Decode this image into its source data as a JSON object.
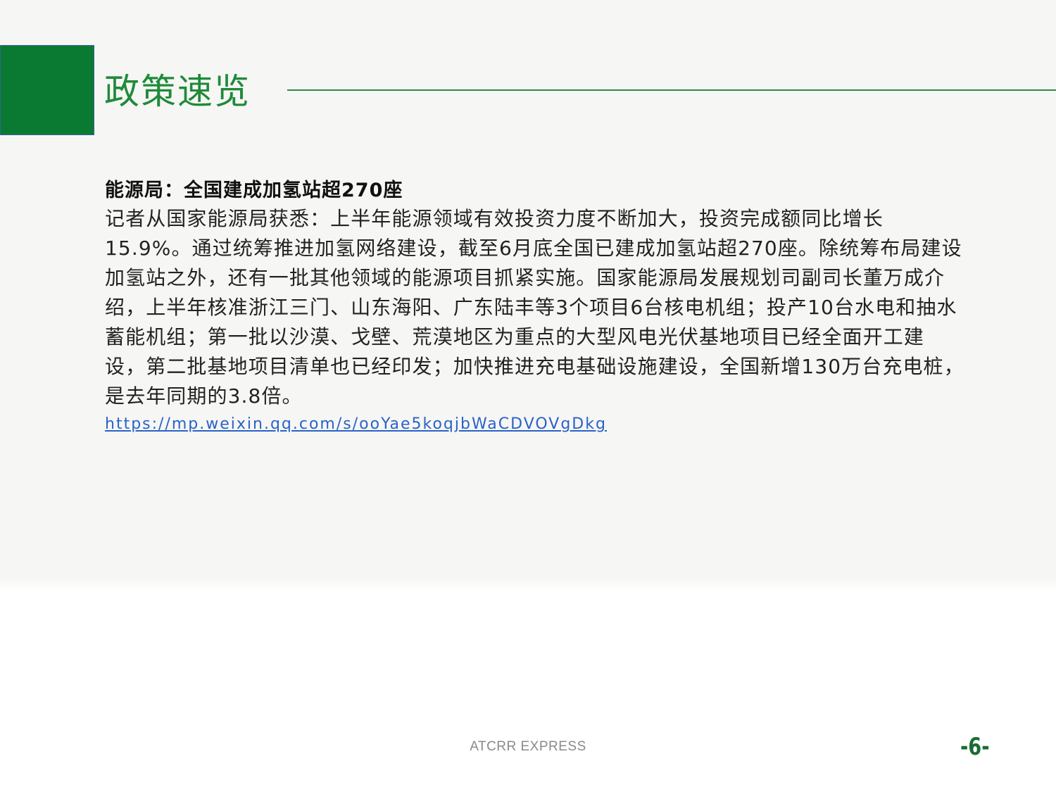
{
  "header": {
    "title": "政策速览",
    "accent_color": "#0a7a32",
    "title_color": "#1f8a3a"
  },
  "article": {
    "headline": "能源局：全国建成加氢站超270座",
    "body": "记者从国家能源局获悉：上半年能源领域有效投资力度不断加大，投资完成额同比增长15.9%。通过统筹推进加氢网络建设，截至6月底全国已建成加氢站超270座。除统筹布局建设加氢站之外，还有一批其他领域的能源项目抓紧实施。国家能源局发展规划司副司长董万成介绍，上半年核准浙江三门、山东海阳、广东陆丰等3个项目6台核电机组；投产10台水电和抽水蓄能机组；第一批以沙漠、戈壁、荒漠地区为重点的大型风电光伏基地项目已经全面开工建设，第二批基地项目清单也已经印发；加快推进充电基础设施建设，全国新增130万台充电桩，是去年同期的3.8倍。",
    "link": "https://mp.weixin.qq.com/s/ooYae5koqjbWaCDVOVgDkg",
    "link_color": "#2a62c9"
  },
  "footer": {
    "brand": "ATCRR EXPRESS",
    "page_number": "-6-"
  }
}
